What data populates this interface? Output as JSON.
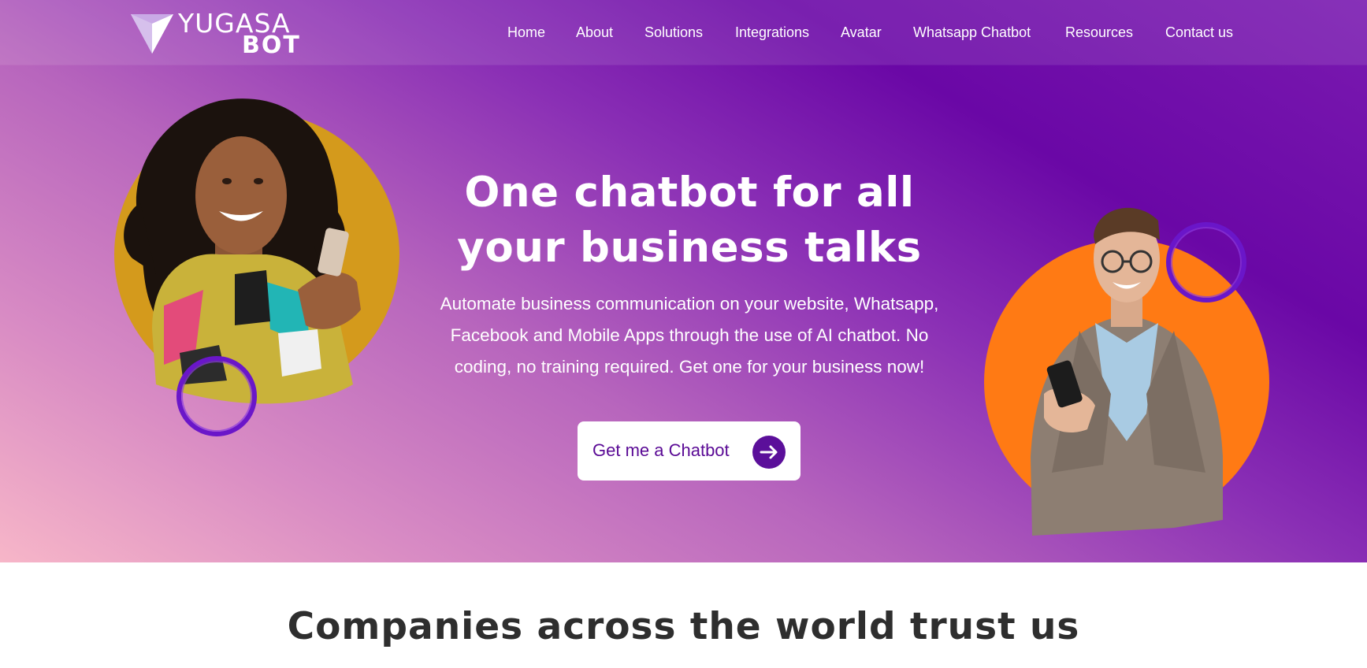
{
  "brand": {
    "logo_top": "YUGASA",
    "logo_bottom": "BOT"
  },
  "nav": {
    "items": [
      {
        "label": "Home"
      },
      {
        "label": "About"
      },
      {
        "label": "Solutions"
      },
      {
        "label": "Integrations"
      },
      {
        "label": "Avatar"
      },
      {
        "label": "Whatsapp Chatbot"
      },
      {
        "label": "Resources"
      },
      {
        "label": "Contact us"
      }
    ]
  },
  "hero": {
    "headline_line1": "One chatbot for all",
    "headline_line2": "your business talks",
    "subtext_line1": "Automate business communication on your website, Whatsapp,",
    "subtext_line2": "Facebook and Mobile Apps through the use of AI chatbot. No",
    "subtext_line3": "coding, no training required. Get one for your business now!",
    "cta_label": "Get me a Chatbot",
    "cta_icon": "arrow-right-icon"
  },
  "trust": {
    "title": "Companies across the world trust us"
  },
  "colors": {
    "accent_purple": "#6a07a6",
    "cta_text": "#5a0a95",
    "mustard": "#d49a1c",
    "orange": "#ff7a14",
    "heading_dark": "#2e2e2e"
  }
}
